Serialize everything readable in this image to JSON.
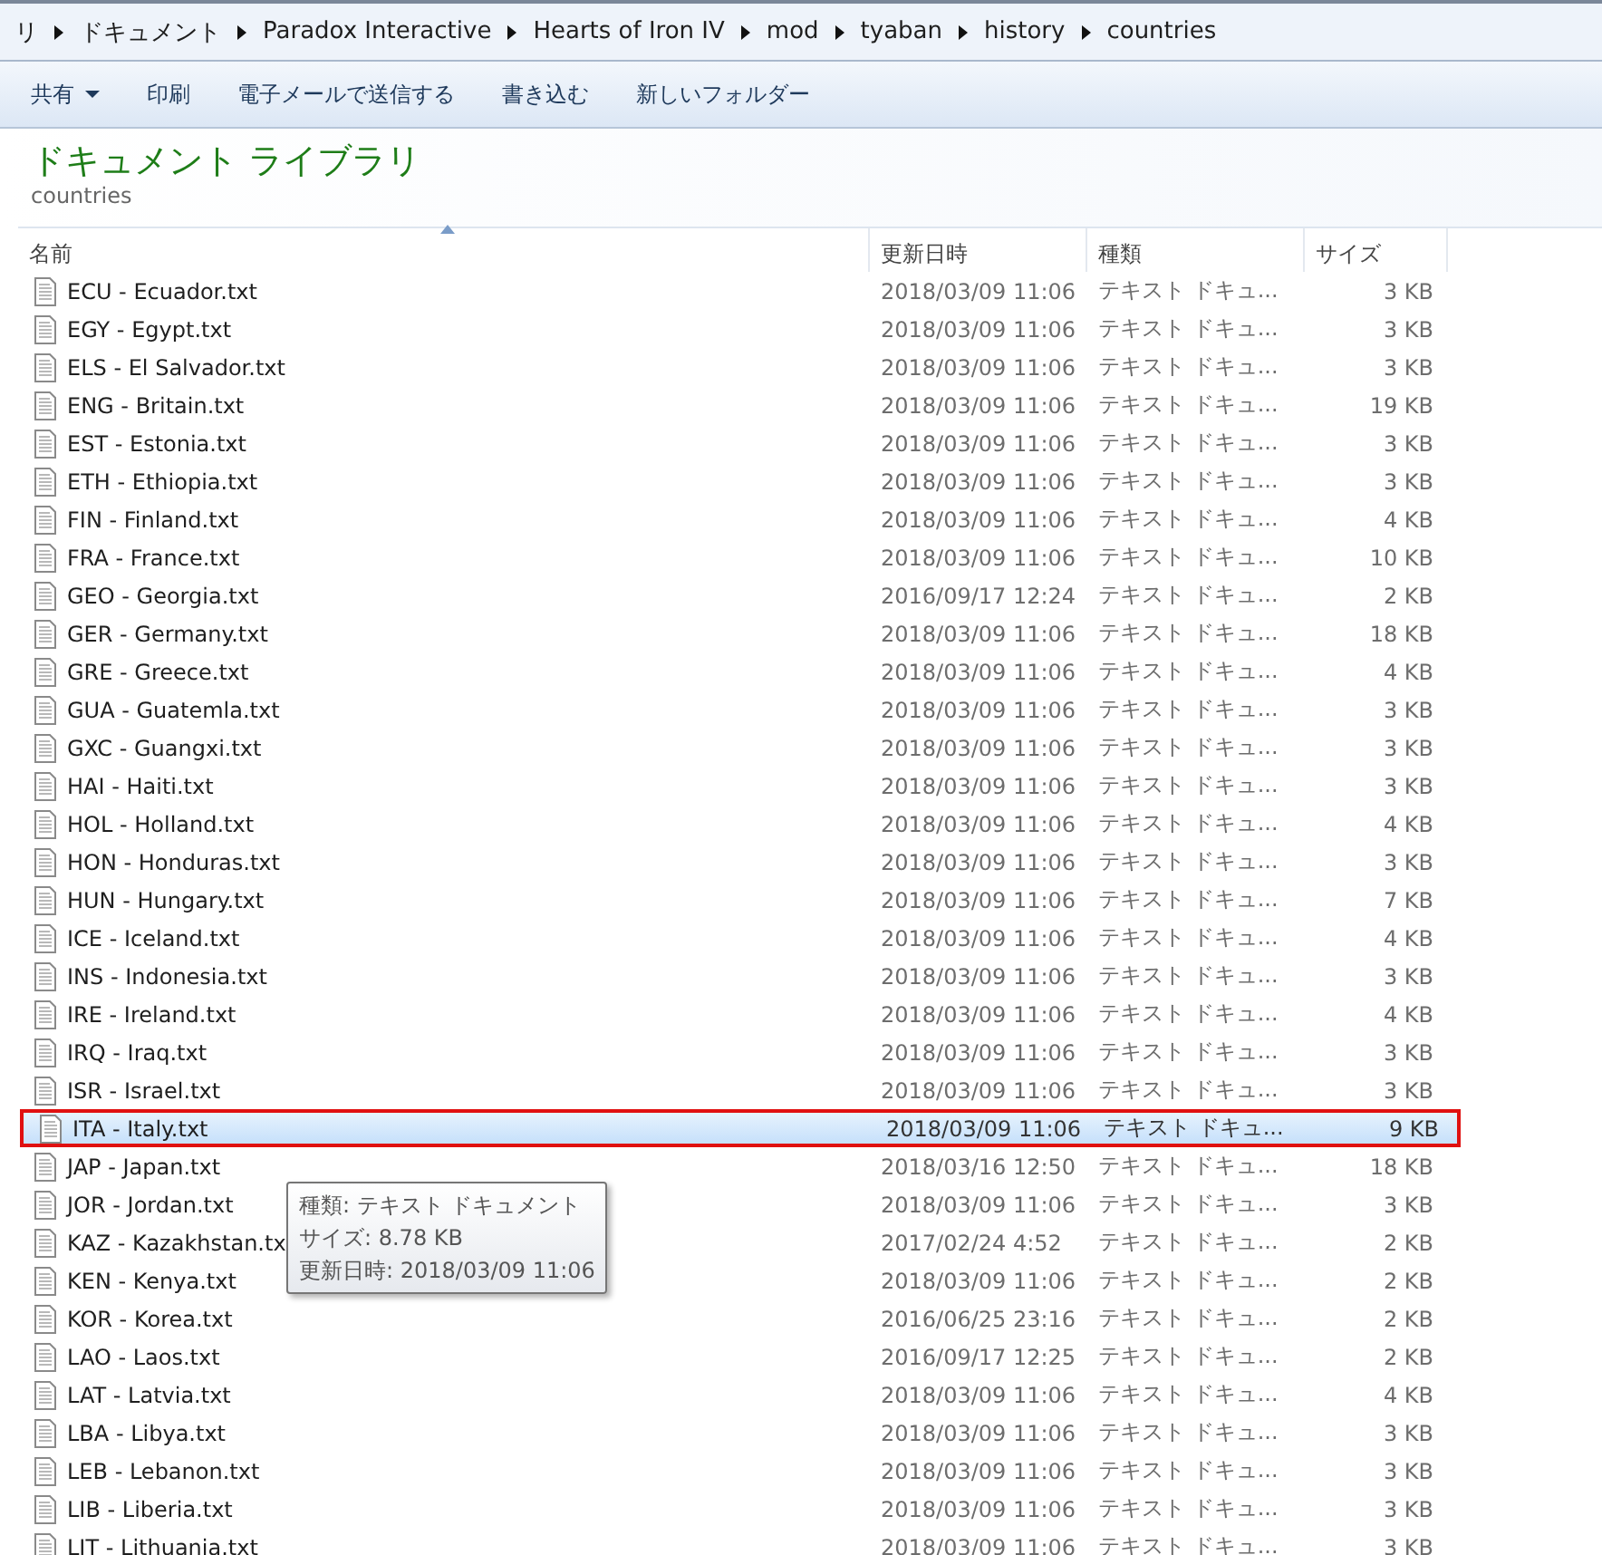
{
  "breadcrumb": [
    "リ",
    "ドキュメント",
    "Paradox Interactive",
    "Hearts of Iron IV",
    "mod",
    "tyaban",
    "history",
    "countries"
  ],
  "toolbar": [
    {
      "label": "共有",
      "dropdown": true
    },
    {
      "label": "印刷",
      "dropdown": false
    },
    {
      "label": "電子メールで送信する",
      "dropdown": false
    },
    {
      "label": "書き込む",
      "dropdown": false
    },
    {
      "label": "新しいフォルダー",
      "dropdown": false
    }
  ],
  "library": {
    "title": "ドキュメント ライブラリ",
    "subtitle": "countries"
  },
  "columns": [
    "名前",
    "更新日時",
    "種類",
    "サイズ"
  ],
  "rows": [
    {
      "name": "ECU - Ecuador.txt",
      "date": "2018/03/09 11:06",
      "type": "テキスト ドキュ...",
      "size": "3 KB",
      "selected": false
    },
    {
      "name": "EGY - Egypt.txt",
      "date": "2018/03/09 11:06",
      "type": "テキスト ドキュ...",
      "size": "3 KB",
      "selected": false
    },
    {
      "name": "ELS - El Salvador.txt",
      "date": "2018/03/09 11:06",
      "type": "テキスト ドキュ...",
      "size": "3 KB",
      "selected": false
    },
    {
      "name": "ENG - Britain.txt",
      "date": "2018/03/09 11:06",
      "type": "テキスト ドキュ...",
      "size": "19 KB",
      "selected": false
    },
    {
      "name": "EST - Estonia.txt",
      "date": "2018/03/09 11:06",
      "type": "テキスト ドキュ...",
      "size": "3 KB",
      "selected": false
    },
    {
      "name": "ETH - Ethiopia.txt",
      "date": "2018/03/09 11:06",
      "type": "テキスト ドキュ...",
      "size": "3 KB",
      "selected": false
    },
    {
      "name": "FIN - Finland.txt",
      "date": "2018/03/09 11:06",
      "type": "テキスト ドキュ...",
      "size": "4 KB",
      "selected": false
    },
    {
      "name": "FRA - France.txt",
      "date": "2018/03/09 11:06",
      "type": "テキスト ドキュ...",
      "size": "10 KB",
      "selected": false
    },
    {
      "name": "GEO - Georgia.txt",
      "date": "2016/09/17 12:24",
      "type": "テキスト ドキュ...",
      "size": "2 KB",
      "selected": false
    },
    {
      "name": "GER - Germany.txt",
      "date": "2018/03/09 11:06",
      "type": "テキスト ドキュ...",
      "size": "18 KB",
      "selected": false
    },
    {
      "name": "GRE - Greece.txt",
      "date": "2018/03/09 11:06",
      "type": "テキスト ドキュ...",
      "size": "4 KB",
      "selected": false
    },
    {
      "name": "GUA - Guatemla.txt",
      "date": "2018/03/09 11:06",
      "type": "テキスト ドキュ...",
      "size": "3 KB",
      "selected": false
    },
    {
      "name": "GXC - Guangxi.txt",
      "date": "2018/03/09 11:06",
      "type": "テキスト ドキュ...",
      "size": "3 KB",
      "selected": false
    },
    {
      "name": "HAI - Haiti.txt",
      "date": "2018/03/09 11:06",
      "type": "テキスト ドキュ...",
      "size": "3 KB",
      "selected": false
    },
    {
      "name": "HOL - Holland.txt",
      "date": "2018/03/09 11:06",
      "type": "テキスト ドキュ...",
      "size": "4 KB",
      "selected": false
    },
    {
      "name": "HON - Honduras.txt",
      "date": "2018/03/09 11:06",
      "type": "テキスト ドキュ...",
      "size": "3 KB",
      "selected": false
    },
    {
      "name": "HUN - Hungary.txt",
      "date": "2018/03/09 11:06",
      "type": "テキスト ドキュ...",
      "size": "7 KB",
      "selected": false
    },
    {
      "name": "ICE - Iceland.txt",
      "date": "2018/03/09 11:06",
      "type": "テキスト ドキュ...",
      "size": "4 KB",
      "selected": false
    },
    {
      "name": "INS - Indonesia.txt",
      "date": "2018/03/09 11:06",
      "type": "テキスト ドキュ...",
      "size": "3 KB",
      "selected": false
    },
    {
      "name": "IRE - Ireland.txt",
      "date": "2018/03/09 11:06",
      "type": "テキスト ドキュ...",
      "size": "4 KB",
      "selected": false
    },
    {
      "name": "IRQ - Iraq.txt",
      "date": "2018/03/09 11:06",
      "type": "テキスト ドキュ...",
      "size": "3 KB",
      "selected": false
    },
    {
      "name": "ISR - Israel.txt",
      "date": "2018/03/09 11:06",
      "type": "テキスト ドキュ...",
      "size": "3 KB",
      "selected": false
    },
    {
      "name": "ITA - Italy.txt",
      "date": "2018/03/09 11:06",
      "type": "テキスト ドキュ...",
      "size": "9 KB",
      "selected": true
    },
    {
      "name": "JAP - Japan.txt",
      "date": "2018/03/16 12:50",
      "type": "テキスト ドキュ...",
      "size": "18 KB",
      "selected": false
    },
    {
      "name": "JOR - Jordan.txt",
      "date": "2018/03/09 11:06",
      "type": "テキスト ドキュ...",
      "size": "3 KB",
      "selected": false
    },
    {
      "name": "KAZ - Kazakhstan.tx",
      "date": "2017/02/24 4:52",
      "type": "テキスト ドキュ...",
      "size": "2 KB",
      "selected": false
    },
    {
      "name": "KEN - Kenya.txt",
      "date": "2018/03/09 11:06",
      "type": "テキスト ドキュ...",
      "size": "2 KB",
      "selected": false
    },
    {
      "name": "KOR - Korea.txt",
      "date": "2016/06/25 23:16",
      "type": "テキスト ドキュ...",
      "size": "2 KB",
      "selected": false
    },
    {
      "name": "LAO - Laos.txt",
      "date": "2016/09/17 12:25",
      "type": "テキスト ドキュ...",
      "size": "2 KB",
      "selected": false
    },
    {
      "name": "LAT - Latvia.txt",
      "date": "2018/03/09 11:06",
      "type": "テキスト ドキュ...",
      "size": "4 KB",
      "selected": false
    },
    {
      "name": "LBA - Libya.txt",
      "date": "2018/03/09 11:06",
      "type": "テキスト ドキュ...",
      "size": "3 KB",
      "selected": false
    },
    {
      "name": "LEB - Lebanon.txt",
      "date": "2018/03/09 11:06",
      "type": "テキスト ドキュ...",
      "size": "3 KB",
      "selected": false
    },
    {
      "name": "LIB - Liberia.txt",
      "date": "2018/03/09 11:06",
      "type": "テキスト ドキュ...",
      "size": "3 KB",
      "selected": false
    },
    {
      "name": "LIT - Lithuania.txt",
      "date": "2018/03/09 11:06",
      "type": "テキスト ドキュ...",
      "size": "3 KB",
      "selected": false
    }
  ],
  "tooltip": [
    "種類: テキスト ドキュメント",
    "サイズ: 8.78 KB",
    "更新日時: 2018/03/09 11:06"
  ]
}
